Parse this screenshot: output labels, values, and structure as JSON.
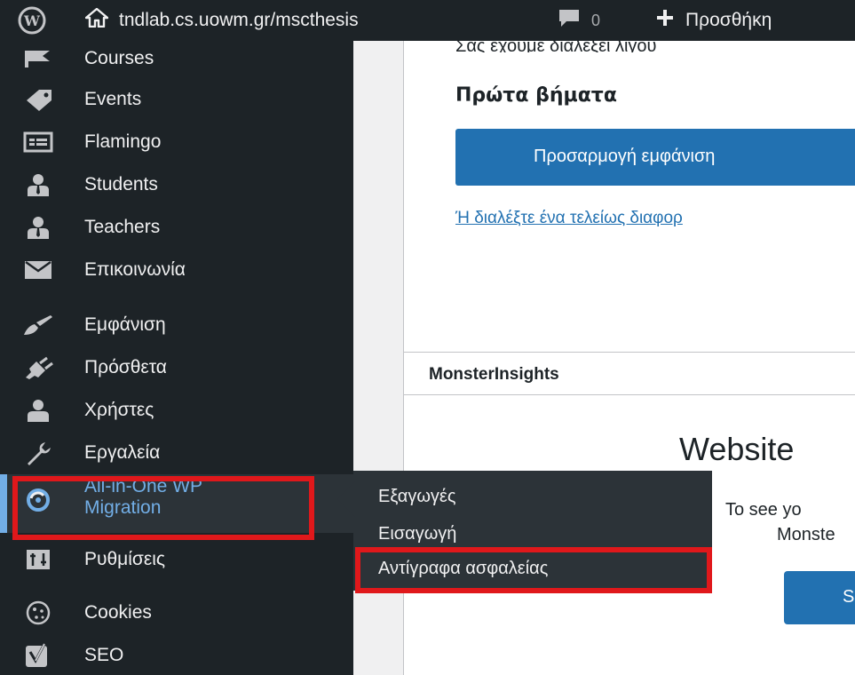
{
  "adminbar": {
    "site_name": "tndlab.cs.uowm.gr/mscthesis",
    "comments_count": "0",
    "new_label": "Προσθήκη",
    "icons": [
      "wordpress-logo-icon",
      "home-icon",
      "comment-icon",
      "plus-icon"
    ]
  },
  "sidebar": {
    "items": [
      {
        "label": "Courses",
        "icon": "flag-icon"
      },
      {
        "label": "Events",
        "icon": "tag-icon"
      },
      {
        "label": "Flamingo",
        "icon": "list-card-icon"
      },
      {
        "label": "Students",
        "icon": "user-tie-icon"
      },
      {
        "label": "Teachers",
        "icon": "user-tie-icon"
      },
      {
        "label": "Επικοινωνία",
        "icon": "envelope-icon"
      },
      {
        "label": "Εμφάνιση",
        "icon": "paintbrush-icon"
      },
      {
        "label": "Πρόσθετα",
        "icon": "plugin-icon"
      },
      {
        "label": "Χρήστες",
        "icon": "user-icon"
      },
      {
        "label": "Εργαλεία",
        "icon": "wrench-icon"
      },
      {
        "label": "All-in-One WP Migration",
        "icon": "migration-icon"
      },
      {
        "label": "Ρυθμίσεις",
        "icon": "settings-sliders-icon"
      },
      {
        "label": "Cookies",
        "icon": "cookie-icon"
      },
      {
        "label": "SEO",
        "icon": "yoast-icon"
      }
    ],
    "active_line1": "All-in-One WP",
    "active_line2": "Migration"
  },
  "flyout": {
    "items": [
      "Εξαγωγές",
      "Εισαγωγή",
      "Αντίγραφα ασφαλείας"
    ]
  },
  "welcome": {
    "intro": "Σας έχουμε διαλέξει λίγου",
    "first_steps": "Πρώτα βήματα",
    "customize_button": "Προσαρμογή εμφάνιση",
    "theme_link": "Ή διαλέξτε ένα τελείως διαφορ"
  },
  "monsterinsights": {
    "title": "MonsterInsights",
    "heading": "Website",
    "text_line1": "To see yo",
    "text_line2": "Monste",
    "button_label": "S"
  },
  "colors": {
    "admin_bg": "#1d2327",
    "submenu_bg": "#2c3338",
    "active_text": "#72aee6",
    "primary_button": "#2271b1",
    "highlight": "#e0181b"
  }
}
